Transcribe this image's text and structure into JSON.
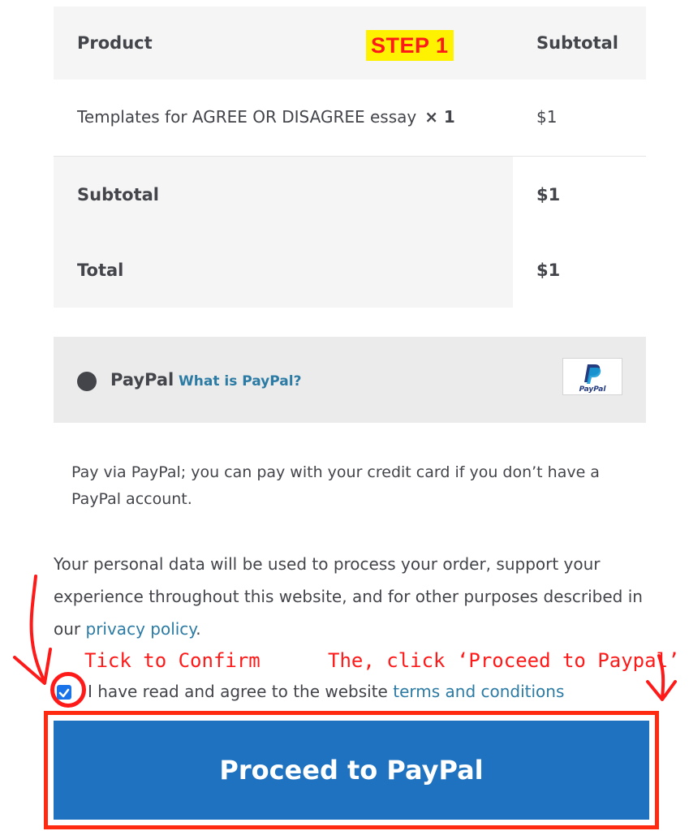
{
  "order_table": {
    "col_product": "Product",
    "col_subtotal": "Subtotal",
    "items": [
      {
        "name": "Templates for AGREE OR DISAGREE essay",
        "qty": "× 1",
        "price": "$1"
      }
    ],
    "subtotal_label": "Subtotal",
    "subtotal_value": "$1",
    "total_label": "Total",
    "total_value": "$1"
  },
  "payment": {
    "method_name": "PayPal",
    "what_is_link": "What is PayPal?",
    "logo_text": "PayPal",
    "description": "Pay via PayPal; you can pay with your credit card if you don’t have a PayPal account."
  },
  "privacy": {
    "text": "Your personal data will be used to process your order, support your experience throughout this website, and for other purposes described in our ",
    "link": "privacy policy",
    "suffix": "."
  },
  "terms": {
    "checked": true,
    "text": "I have read and agree to the website ",
    "link": "terms and conditions"
  },
  "proceed_button": "Proceed to PayPal",
  "annotations": {
    "step": "STEP 1",
    "tick_hint": "Tick to Confirm",
    "click_hint": "The, click ‘Proceed to Paypal’"
  },
  "colors": {
    "accent": "#1f72bf",
    "link": "#2c7ba4",
    "annotation": "#ff1a1a",
    "highlight": "#fff200"
  }
}
